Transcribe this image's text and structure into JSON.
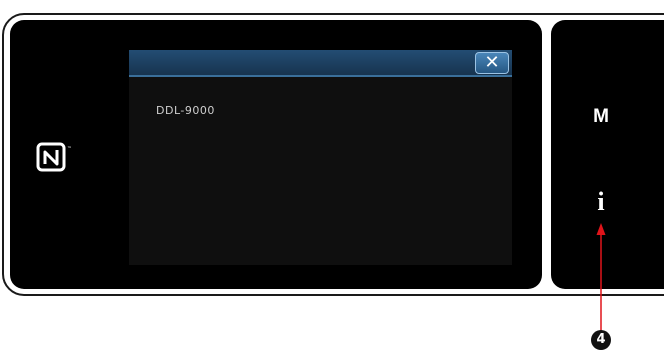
{
  "popup": {
    "close_label": "✕",
    "model_name": "DDL-9000"
  },
  "side_panel": {
    "mode_key_label": "M",
    "info_key_label": "i"
  },
  "callout": {
    "number": "4"
  },
  "colors": {
    "screen_bg": "#000000",
    "popup_header": "#1f4466",
    "close_button": "#3a74a8",
    "callout_arrow": "#e0141a"
  },
  "icons": [
    "nfc-icon",
    "close-icon",
    "info-icon"
  ]
}
